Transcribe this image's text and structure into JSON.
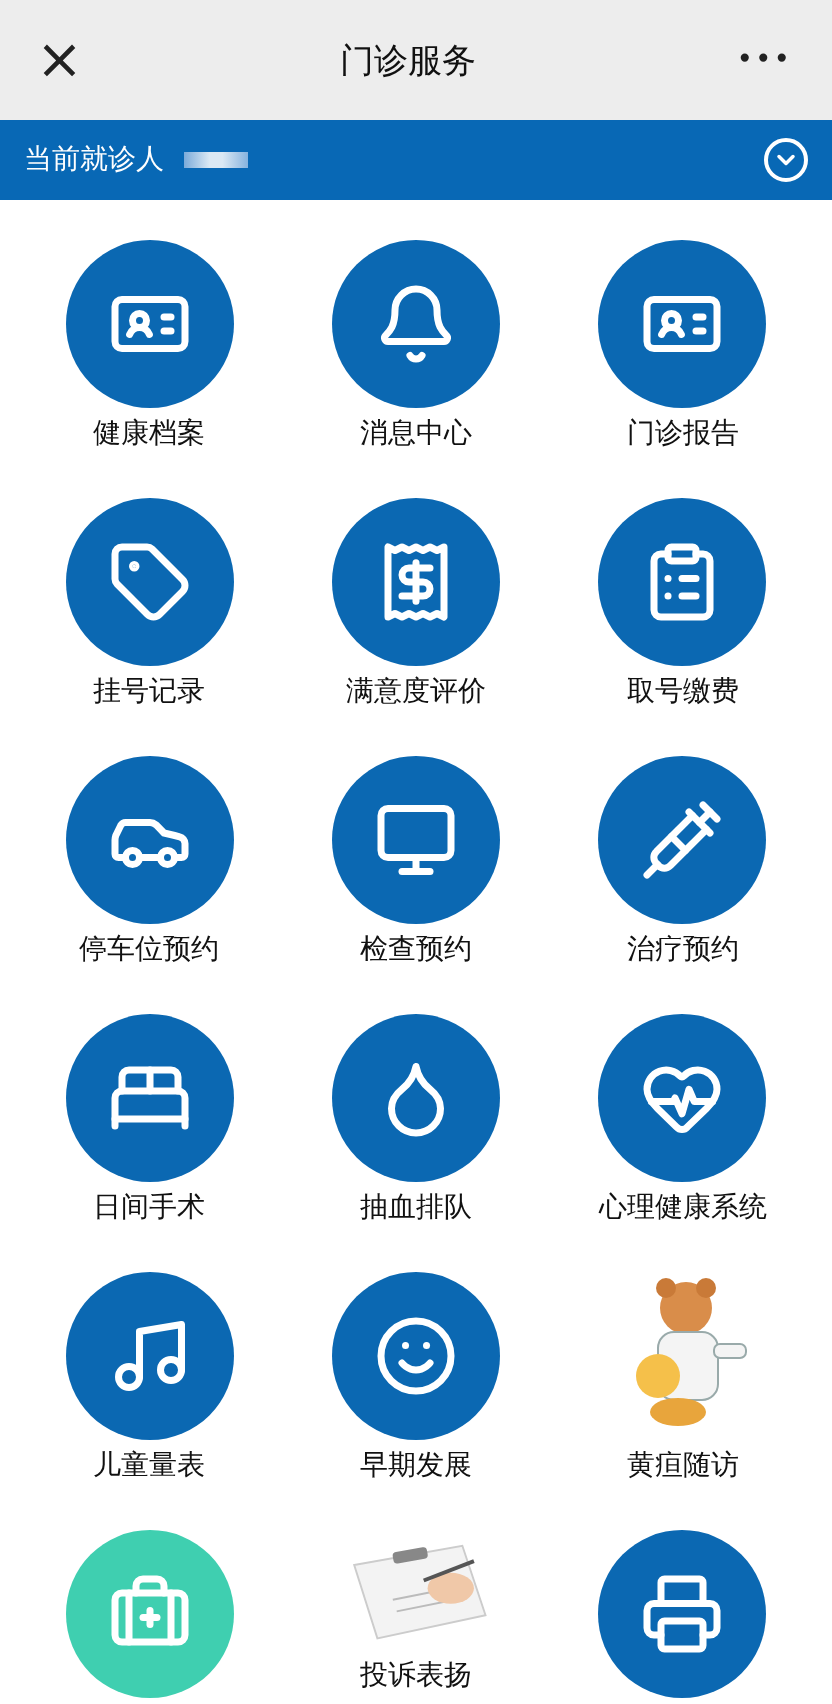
{
  "header": {
    "close": "×",
    "title": "门诊服务",
    "more": "•••"
  },
  "patient_bar": {
    "label": "当前就诊人"
  },
  "services": [
    {
      "kind": "icon",
      "color": "#0b68b2",
      "label": "健康档案"
    },
    {
      "kind": "icon",
      "color": "#0b68b2",
      "label": "消息中心"
    },
    {
      "kind": "icon",
      "color": "#0b68b2",
      "label": "门诊报告"
    },
    {
      "kind": "icon",
      "color": "#0b68b2",
      "label": "挂号记录"
    },
    {
      "kind": "icon",
      "color": "#0b68b2",
      "label": "满意度评价"
    },
    {
      "kind": "icon",
      "color": "#0b68b2",
      "label": "取号缴费"
    },
    {
      "kind": "icon",
      "color": "#0b68b2",
      "label": "停车位预约"
    },
    {
      "kind": "icon",
      "color": "#0b68b2",
      "label": "检查预约"
    },
    {
      "kind": "icon",
      "color": "#0b68b2",
      "label": "治疗预约"
    },
    {
      "kind": "icon",
      "color": "#0b68b2",
      "label": "日间手术"
    },
    {
      "kind": "icon",
      "color": "#0b68b2",
      "label": "抽血排队"
    },
    {
      "kind": "icon",
      "color": "#0b68b2",
      "label": "心理健康系统"
    },
    {
      "kind": "icon",
      "color": "#0b68b2",
      "label": "儿童量表"
    },
    {
      "kind": "icon",
      "color": "#0b68b2",
      "label": "早期发展"
    },
    {
      "kind": "picture",
      "label": "黄疸随访"
    },
    {
      "kind": "icon",
      "color": "#3fcfb0"
    },
    {
      "kind": "picture",
      "label": "投诉表扬"
    },
    {
      "kind": "icon",
      "color": "#0b68b2"
    }
  ]
}
